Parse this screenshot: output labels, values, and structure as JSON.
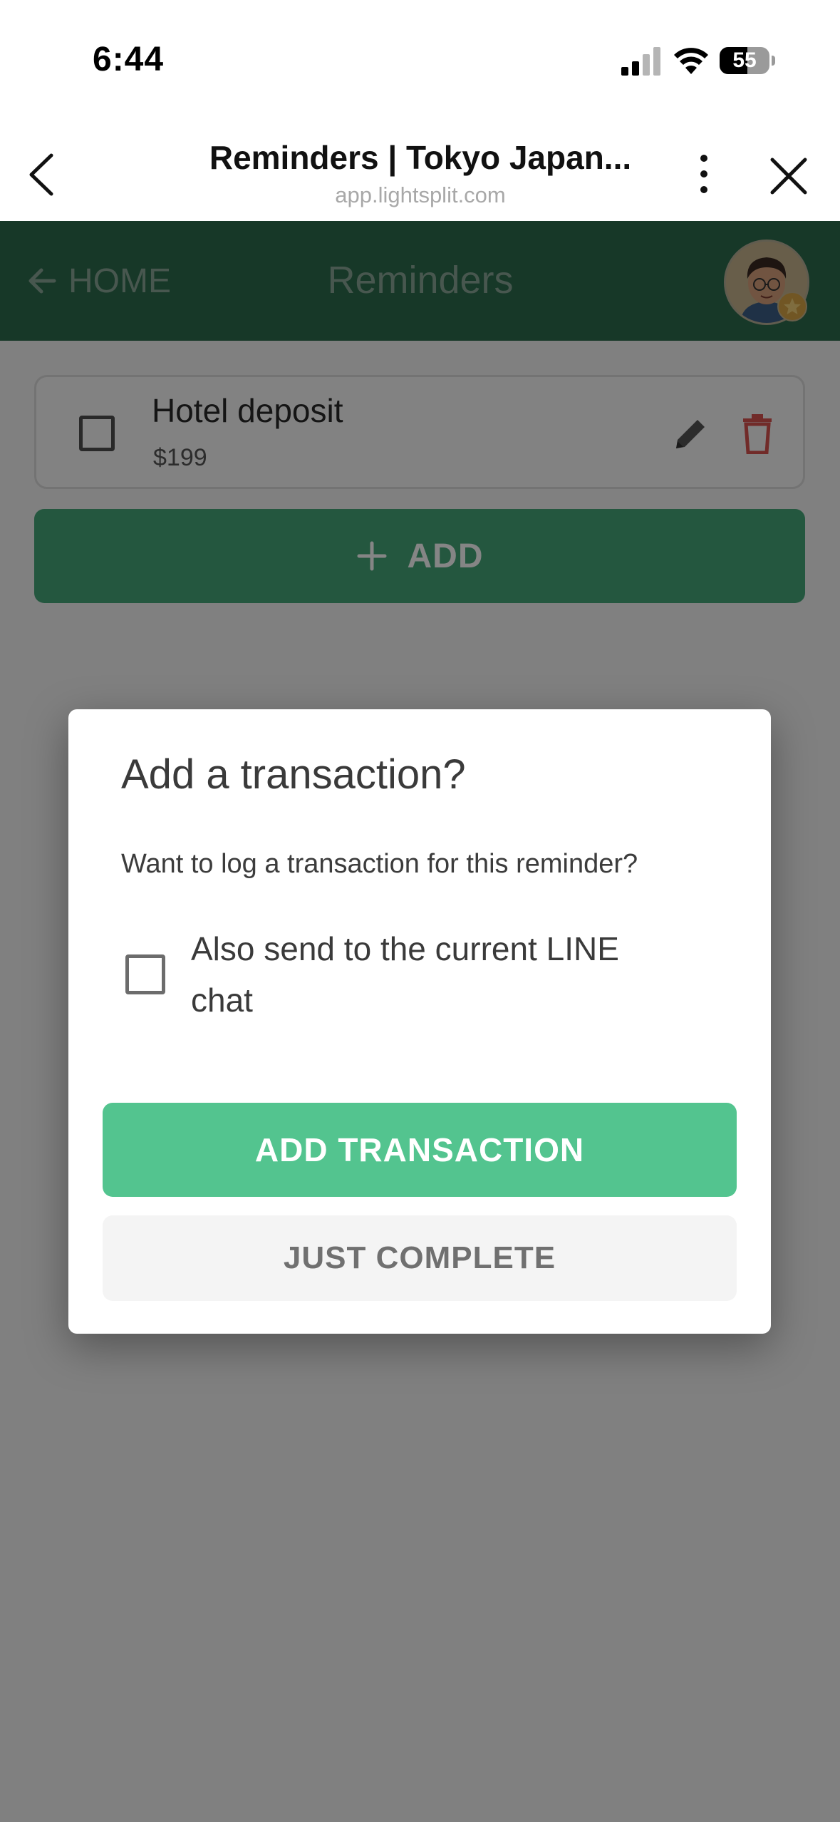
{
  "status_bar": {
    "time": "6:44",
    "battery_level": "55",
    "battery_fraction": 0.55
  },
  "browser": {
    "title": "Reminders | Tokyo Japan...",
    "url": "app.lightsplit.com",
    "icons": [
      "back-chevron-icon",
      "more-vertical-icon",
      "close-icon"
    ]
  },
  "app_header": {
    "home_label": "HOME",
    "title": "Reminders",
    "color": "#2d6b4e"
  },
  "reminders": [
    {
      "title": "Hotel deposit",
      "amount": "$199",
      "checked": false
    }
  ],
  "add_button": {
    "label": "ADD"
  },
  "dialog": {
    "title": "Add a transaction?",
    "message": "Want to log a transaction for this reminder?",
    "checkbox_label": "Also send to the current LINE chat",
    "checkbox_checked": false,
    "primary_button": "ADD TRANSACTION",
    "secondary_button": "JUST COMPLETE"
  },
  "colors": {
    "primary_green": "#53c48f",
    "header_green": "#2d6b4e",
    "danger_red": "#d9534f"
  }
}
